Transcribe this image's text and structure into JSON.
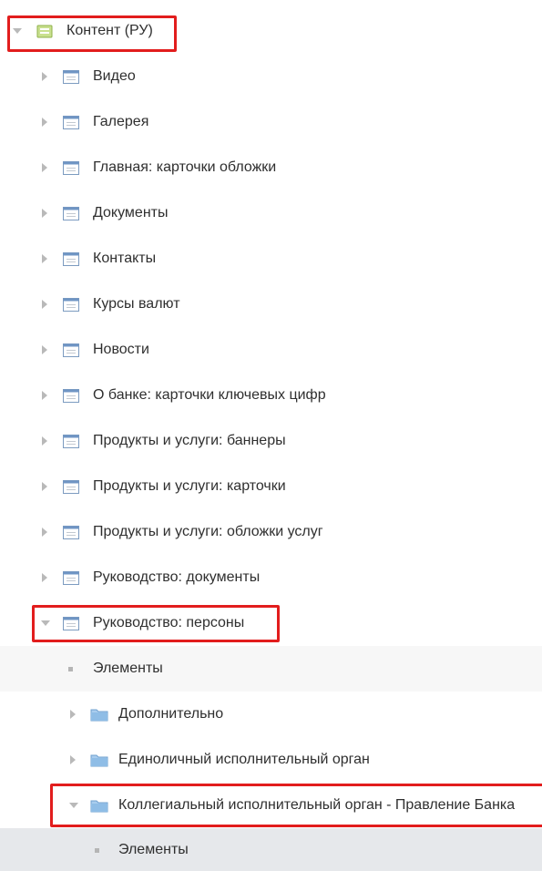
{
  "tree": {
    "root": {
      "label": "Контент (РУ)",
      "icon": "green-folder-icon",
      "expanded": true
    },
    "items": [
      {
        "label": "Видео",
        "icon": "calendar-icon",
        "expanded": false
      },
      {
        "label": "Галерея",
        "icon": "calendar-icon",
        "expanded": false
      },
      {
        "label": "Главная: карточки обложки",
        "icon": "calendar-icon",
        "expanded": false
      },
      {
        "label": "Документы",
        "icon": "calendar-icon",
        "expanded": false
      },
      {
        "label": "Контакты",
        "icon": "calendar-icon",
        "expanded": false
      },
      {
        "label": "Курсы валют",
        "icon": "calendar-icon",
        "expanded": false
      },
      {
        "label": "Новости",
        "icon": "calendar-icon",
        "expanded": false
      },
      {
        "label": "О банке: карточки ключевых цифр",
        "icon": "calendar-icon",
        "expanded": false
      },
      {
        "label": "Продукты и услуги: баннеры",
        "icon": "calendar-icon",
        "expanded": false
      },
      {
        "label": "Продукты и услуги: карточки",
        "icon": "calendar-icon",
        "expanded": false
      },
      {
        "label": "Продукты и услуги: обложки услуг",
        "icon": "calendar-icon",
        "expanded": false
      },
      {
        "label": "Руководство: документы",
        "icon": "calendar-icon",
        "expanded": false
      },
      {
        "label": "Руководство: персоны",
        "icon": "calendar-icon",
        "expanded": true
      }
    ],
    "persons_children": [
      {
        "label": "Элементы",
        "icon": "bullet"
      },
      {
        "label": "Дополнительно",
        "icon": "blue-folder-icon",
        "expanded": false
      },
      {
        "label": "Единоличный исполнительный орган",
        "icon": "blue-folder-icon",
        "expanded": false
      },
      {
        "label": "Коллегиальный исполнительный орган - Правление Банка",
        "icon": "blue-folder-icon",
        "expanded": true
      }
    ],
    "board_children": [
      {
        "label": "Элементы",
        "icon": "bullet"
      }
    ]
  },
  "colors": {
    "highlight_border": "#e21d1d",
    "selected_row": "#e6e8eb",
    "alt_row": "#f7f7f7",
    "folder_blue": "#7fb2dd",
    "folder_green": "#9cc55b"
  }
}
